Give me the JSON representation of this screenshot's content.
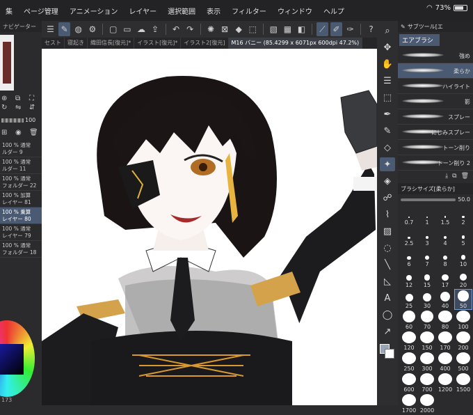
{
  "status": {
    "battery": "73%"
  },
  "menu": [
    "集",
    "ページ管理",
    "アニメーション",
    "レイヤー",
    "選択範囲",
    "表示",
    "フィルター",
    "ウィンドウ",
    "ヘルプ"
  ],
  "tabs": [
    {
      "label": "セスト",
      "active": false
    },
    {
      "label": "寝起き",
      "active": false
    },
    {
      "label": "織田信長[復元]*",
      "active": false
    },
    {
      "label": "イラスト[復元]*",
      "active": false
    },
    {
      "label": "イラスト2[復元]",
      "active": false
    },
    {
      "label": "M16 バニー (85.4299 x 6071px 600dpi 47.2%)",
      "active": true
    }
  ],
  "left": {
    "navigator_title": "ナビゲーター",
    "opacity_value": "100",
    "layers": [
      {
        "line1": "100 % 通常",
        "line2": "ルダー 9",
        "selected": false
      },
      {
        "line1": "100 % 通常",
        "line2": "ルダー 11",
        "selected": false
      },
      {
        "line1": "100 % 通常",
        "line2": "フォルダー 22",
        "selected": false
      },
      {
        "line1": "100 % 加算",
        "line2": "レイヤー 81",
        "selected": false
      },
      {
        "line1": "100 % 乗算",
        "line2": "レイヤー 80",
        "selected": true
      },
      {
        "line1": "100 % 通常",
        "line2": "レイヤー 79",
        "selected": false
      },
      {
        "line1": "100 % 通常",
        "line2": "フォルダー 18",
        "selected": false
      }
    ],
    "footer_value": "173"
  },
  "subtool": {
    "title": "サブツール[エ",
    "group": "エアブラシ",
    "brushes": [
      {
        "label": "強め",
        "selected": false
      },
      {
        "label": "柔らか",
        "selected": true
      },
      {
        "label": "ハイライト",
        "selected": false
      },
      {
        "label": "影",
        "selected": false
      },
      {
        "label": "スプレー",
        "selected": false
      },
      {
        "label": "にじみスプレー",
        "selected": false
      },
      {
        "label": "トーン削り",
        "selected": false
      },
      {
        "label": "トーン削り 2",
        "selected": false
      }
    ]
  },
  "brush_size": {
    "title": "ブラシサイズ[柔らか]",
    "value": "50.0",
    "sizes": [
      "0.7",
      "1",
      "1.5",
      "2",
      "2.5",
      "3",
      "4",
      "5",
      "6",
      "7",
      "8",
      "10",
      "12",
      "15",
      "17",
      "20",
      "25",
      "30",
      "40",
      "50",
      "60",
      "70",
      "80",
      "100",
      "120",
      "150",
      "170",
      "200",
      "250",
      "300",
      "400",
      "500",
      "600",
      "700",
      "1200",
      "1500",
      "1700",
      "2000"
    ],
    "selected": "50"
  },
  "colors": {
    "accent": "#4a5a72",
    "canvas": "#ffffff"
  }
}
